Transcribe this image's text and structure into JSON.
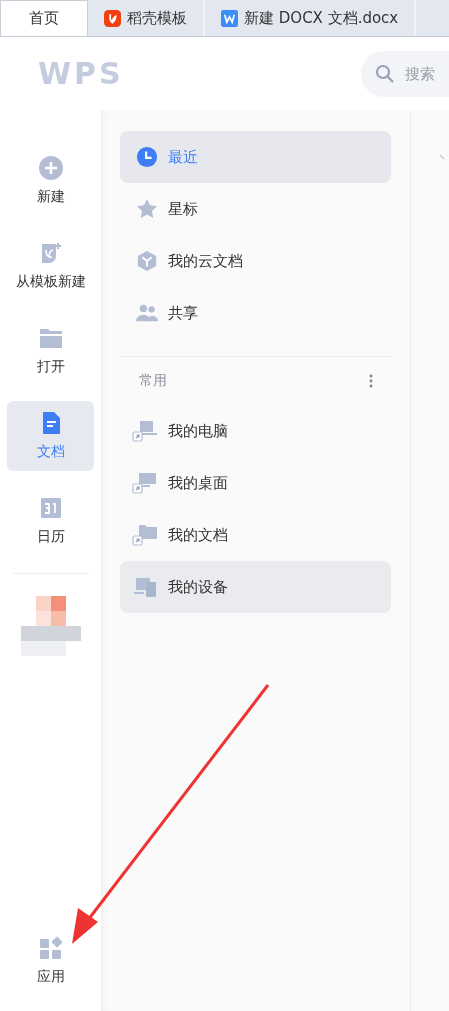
{
  "tabs": [
    {
      "label": "首页",
      "selected": true
    },
    {
      "label": "稻壳模板",
      "selected": false
    },
    {
      "label": "新建 DOCX 文档.docx",
      "selected": false
    }
  ],
  "header": {
    "logo": "WPS",
    "search": {
      "placeholder": "搜索"
    }
  },
  "sidebar": {
    "items": [
      {
        "label": "新建",
        "selected": false
      },
      {
        "label": "从模板新建",
        "selected": false
      },
      {
        "label": "打开",
        "selected": false
      },
      {
        "label": "文档",
        "selected": true
      },
      {
        "label": "日历",
        "selected": false
      }
    ],
    "apps": {
      "label": "应用"
    }
  },
  "nav": {
    "items": [
      {
        "label": "最近",
        "selected": true
      },
      {
        "label": "星标",
        "selected": false
      },
      {
        "label": "我的云文档",
        "selected": false
      },
      {
        "label": "共享",
        "selected": false
      }
    ],
    "section": {
      "title": "常用",
      "items": [
        {
          "label": "我的电脑",
          "highlighted": false
        },
        {
          "label": "我的桌面",
          "highlighted": false
        },
        {
          "label": "我的文档",
          "highlighted": false
        },
        {
          "label": "我的设备",
          "highlighted": true
        }
      ]
    }
  }
}
